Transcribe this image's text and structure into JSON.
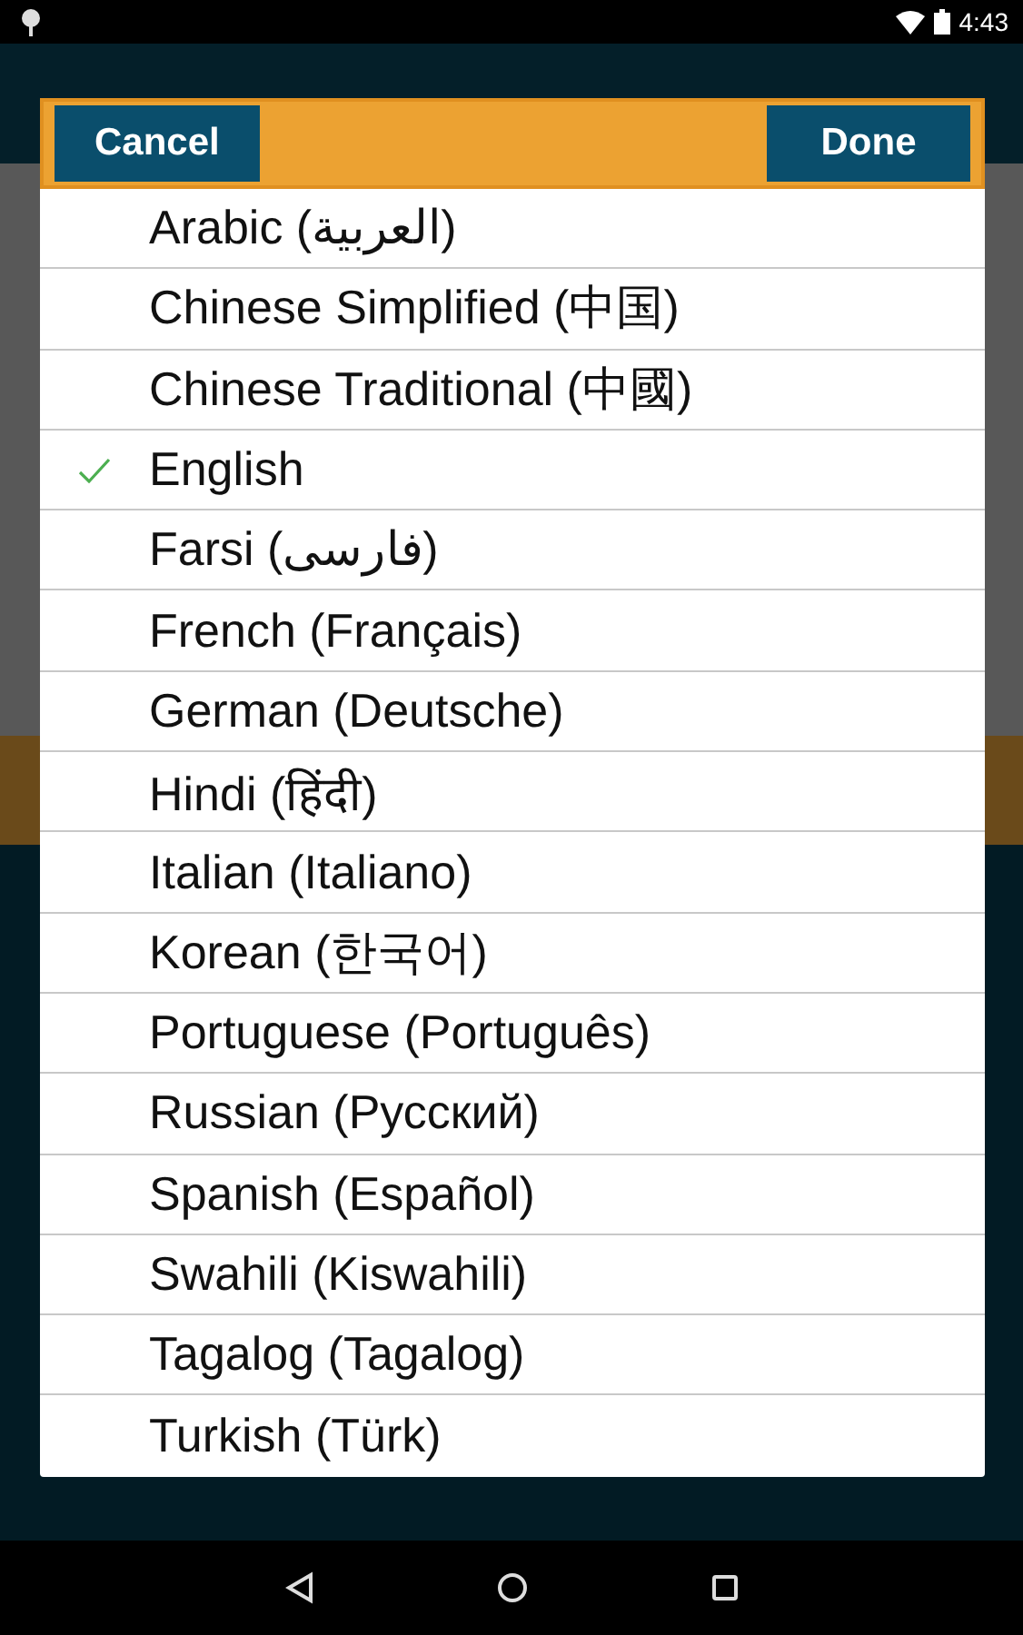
{
  "status_bar": {
    "time": "4:43"
  },
  "dialog": {
    "buttons": [
      {
        "label": "Cancel",
        "kind": "cancel"
      },
      {
        "label": "Done",
        "kind": "done"
      }
    ],
    "languages": [
      {
        "label": "Arabic (العربية)",
        "selected": false
      },
      {
        "label": "Chinese Simplified (中国)",
        "selected": false
      },
      {
        "label": "Chinese Traditional (中國)",
        "selected": false
      },
      {
        "label": "English",
        "selected": true
      },
      {
        "label": "Farsi (فارسی)",
        "selected": false
      },
      {
        "label": "French (Français)",
        "selected": false
      },
      {
        "label": "German (Deutsche)",
        "selected": false
      },
      {
        "label": "Hindi (हिंदी)",
        "selected": false
      },
      {
        "label": "Italian (Italiano)",
        "selected": false
      },
      {
        "label": "Korean (한국어)",
        "selected": false
      },
      {
        "label": "Portuguese (Português)",
        "selected": false
      },
      {
        "label": "Russian (Русский)",
        "selected": false
      },
      {
        "label": "Spanish (Español)",
        "selected": false
      },
      {
        "label": "Swahili (Kiswahili)",
        "selected": false
      },
      {
        "label": "Tagalog (Tagalog)",
        "selected": false
      },
      {
        "label": "Turkish (Türk)",
        "selected": false
      }
    ]
  }
}
